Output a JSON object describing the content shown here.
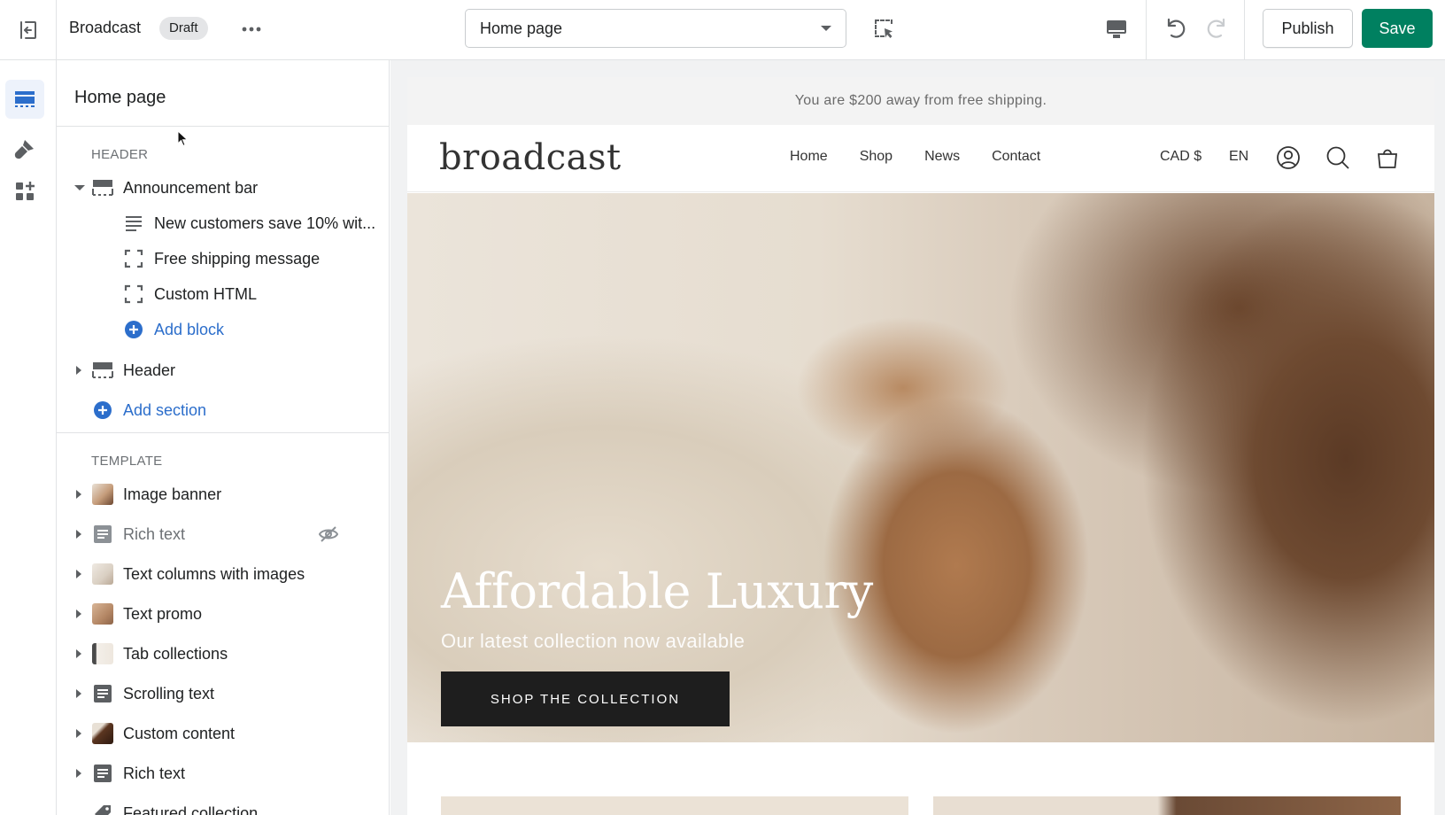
{
  "topbar": {
    "theme_name": "Broadcast",
    "status_badge": "Draft",
    "page_select": "Home page",
    "publish_label": "Publish",
    "save_label": "Save"
  },
  "rail": {
    "items": [
      "sections-icon",
      "theme-settings-icon",
      "app-embeds-icon"
    ]
  },
  "sidebar": {
    "title": "Home page",
    "header_group": "HEADER",
    "header_sections": [
      {
        "label": "Announcement bar",
        "expanded": true,
        "blocks": [
          "New customers save 10% wit...",
          "Free shipping message",
          "Custom HTML"
        ],
        "add_block": "Add block"
      },
      {
        "label": "Header",
        "expanded": false
      }
    ],
    "add_section": "Add section",
    "template_group": "TEMPLATE",
    "template_sections": [
      {
        "label": "Image banner"
      },
      {
        "label": "Rich text",
        "hidden": true
      },
      {
        "label": "Text columns with images"
      },
      {
        "label": "Text promo"
      },
      {
        "label": "Tab collections"
      },
      {
        "label": "Scrolling text"
      },
      {
        "label": "Custom content"
      },
      {
        "label": "Rich text"
      },
      {
        "label": "Featured collection"
      }
    ]
  },
  "preview": {
    "announcement": "You are $200 away from free shipping.",
    "logo": "broadcast",
    "nav": [
      "Home",
      "Shop",
      "News",
      "Contact"
    ],
    "currency": "CAD $",
    "language": "EN",
    "hero_title": "Affordable Luxury",
    "hero_subtitle": "Our latest collection now available",
    "hero_cta": "SHOP THE COLLECTION"
  },
  "colors": {
    "primary_green": "#008060",
    "link_blue": "#2c6ecb",
    "rail_active_bg": "#edf2fb"
  }
}
